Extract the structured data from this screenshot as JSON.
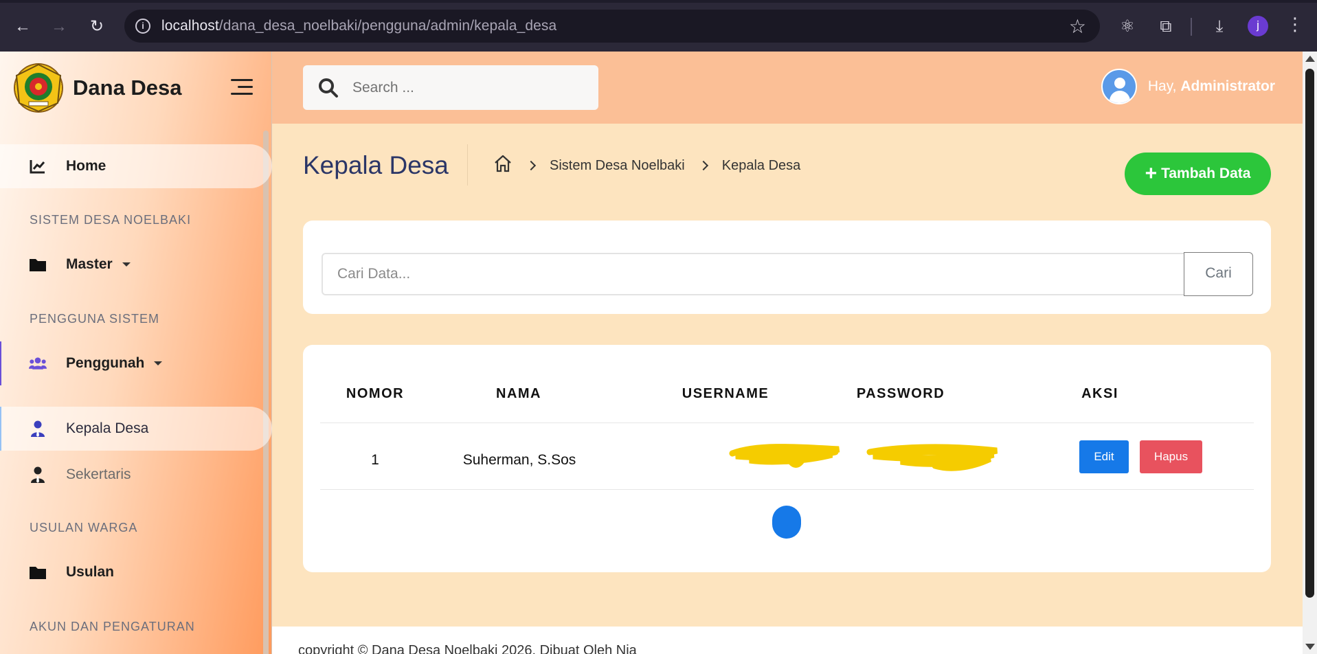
{
  "browser": {
    "url_host": "localhost",
    "url_path": "/dana_desa_noelbaki/pengguna/admin/kepala_desa",
    "profile_initial": "j"
  },
  "sidebar": {
    "brand": "Dana Desa",
    "home": "Home",
    "section_sistem": "SISTEM DESA NOELBAKI",
    "master": "Master",
    "section_pengguna": "PENGGUNA SISTEM",
    "penggunah": "Penggunah",
    "kepala_desa": "Kepala Desa",
    "sekertaris": "Sekertaris",
    "section_usulan": "USULAN WARGA",
    "usulan": "Usulan",
    "section_akun": "AKUN DAN PENGATURAN"
  },
  "topbar": {
    "search_placeholder": "Search ...",
    "greeting": "Hay,",
    "username": "Administrator"
  },
  "page": {
    "title": "Kepala Desa",
    "breadcrumb": [
      "Sistem Desa Noelbaki",
      "Kepala Desa"
    ],
    "add_button": "Tambah Data"
  },
  "filter": {
    "placeholder": "Cari Data...",
    "button": "Cari"
  },
  "table": {
    "headers": [
      "NOMOR",
      "NAMA",
      "USERNAME",
      "PASSWORD",
      "AKSI"
    ],
    "rows": [
      {
        "nomor": "1",
        "nama": "Suherman, S.Sos",
        "edit": "Edit",
        "hapus": "Hapus"
      }
    ]
  },
  "pagination": {
    "current": "1"
  },
  "footer": {
    "text": "copyright © Dana Desa Noelbaki 2026. Dibuat Oleh Nia"
  },
  "colors": {
    "accent_green": "#2cc63b",
    "edit_blue": "#1679e8",
    "delete_red": "#e8525e",
    "topbar": "#fbbf96",
    "content_bg": "#fde4bf",
    "title_navy": "#2b3667"
  }
}
